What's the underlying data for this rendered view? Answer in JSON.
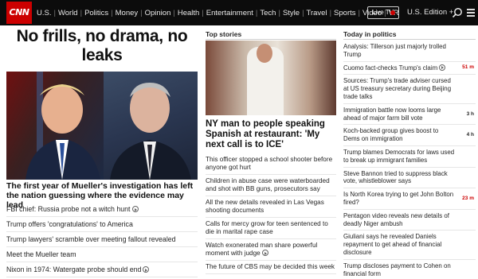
{
  "nav": {
    "logo": "CNN",
    "links": [
      "U.S.",
      "World",
      "Politics",
      "Money",
      "Opinion",
      "Health",
      "Entertainment",
      "Tech",
      "Style",
      "Travel",
      "Sports",
      "Video",
      "VR"
    ],
    "live_tv": "Live TV",
    "edition": "U.S. Edition +",
    "icons": [
      "search-icon",
      "menu-icon"
    ],
    "accent": "#cc0000",
    "bar_color": "#0c0c0c"
  },
  "left": {
    "headline": "No frills, no drama, no leaks",
    "caption": "The first year of Mueller's investigation has left the nation guessing where the evidence may lead",
    "items": [
      {
        "text": "FBI chief: Russia probe not a witch hunt",
        "video": true
      },
      {
        "text": "Trump offers 'congratulations' to America",
        "video": false
      },
      {
        "text": "Trump lawyers' scramble over meeting fallout revealed",
        "video": false
      },
      {
        "text": "Meet the Mueller team",
        "video": false
      },
      {
        "text": "Nixon in 1974: Watergate probe should end",
        "video": true
      }
    ]
  },
  "center": {
    "section_title": "Top stories",
    "headline": "NY man to people speaking Spanish at restaurant: 'My next call is to ICE'",
    "items": [
      "This officer stopped a school shooter before anyone got hurt",
      "Children in abuse case were waterboarded and shot with BB guns, prosecutors say",
      "All the new details revealed in Las Vegas shooting documents",
      "Calls for mercy grow for teen sentenced to die in marital rape case",
      "Watch exonerated man share powerful moment with judge",
      "The future of CBS may be decided this week"
    ],
    "video_flags": [
      false,
      false,
      false,
      false,
      true,
      false
    ]
  },
  "right": {
    "section_title": "Today in politics",
    "items": [
      {
        "text": "Analysis: Tillerson just majorly trolled Trump",
        "time": "",
        "red": false,
        "video": false
      },
      {
        "text": "Cuomo fact-checks Trump's claim",
        "time": "51 m",
        "red": true,
        "video": true
      },
      {
        "text": "Sources: Trump's trade adviser cursed at US treasury secretary during Beijing trade talks",
        "time": "",
        "red": false,
        "video": false
      },
      {
        "text": "Immigration battle now looms large ahead of major farm bill vote",
        "time": "3 h",
        "red": false,
        "video": false
      },
      {
        "text": "Koch-backed group gives boost to Dems on immigration",
        "time": "4 h",
        "red": false,
        "video": false
      },
      {
        "text": "Trump blames Democrats for laws used to break up immigrant families",
        "time": "",
        "red": false,
        "video": false
      },
      {
        "text": "Steve Bannon tried to suppress black vote, whistleblower says",
        "time": "",
        "red": false,
        "video": false
      },
      {
        "text": "Is North Korea trying to get John Bolton fired?",
        "time": "23 m",
        "red": true,
        "video": false
      },
      {
        "text": "Pentagon video reveals new details of deadly Niger ambush",
        "time": "",
        "red": false,
        "video": false
      },
      {
        "text": "Giuliani says he revealed Daniels repayment to get ahead of financial disclosure",
        "time": "",
        "red": false,
        "video": false
      },
      {
        "text": "Trump discloses payment to Cohen on financial form",
        "time": "",
        "red": false,
        "video": false
      }
    ]
  }
}
